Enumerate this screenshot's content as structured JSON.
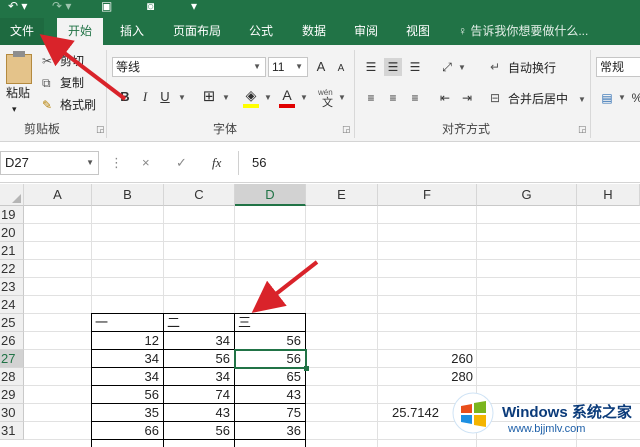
{
  "ribbon_tabs": [
    "文件",
    "开始",
    "插入",
    "页面布局",
    "公式",
    "数据",
    "审阅",
    "视图"
  ],
  "tell_me": "告诉我你想要做什么...",
  "clipboard": {
    "paste": "粘贴",
    "cut": "剪切",
    "copy": "复制",
    "format_painter": "格式刷",
    "label": "剪贴板"
  },
  "font": {
    "name": "等线",
    "size": "11",
    "label": "字体",
    "grow": "A",
    "shrink": "A",
    "bold": "B",
    "italic": "I",
    "underline": "U",
    "font_color": "A",
    "phonetic": "wén"
  },
  "alignment": {
    "wrap": "自动换行",
    "merge": "合并后居中",
    "label": "对齐方式"
  },
  "number": {
    "format": "常规"
  },
  "formula_bar": {
    "name_box": "D27",
    "fx": "fx",
    "cancel": "×",
    "enter": "✓",
    "value": "56"
  },
  "columns": [
    "A",
    "B",
    "C",
    "D",
    "E",
    "F",
    "G",
    "H"
  ],
  "rows": [
    "19",
    "20",
    "21",
    "22",
    "23",
    "24",
    "25",
    "26",
    "27",
    "28",
    "29",
    "30",
    "31"
  ],
  "table": {
    "headers": [
      "一",
      "二",
      "三"
    ],
    "rows": [
      [
        "12",
        "34",
        "56"
      ],
      [
        "34",
        "56",
        "56"
      ],
      [
        "34",
        "34",
        "65"
      ],
      [
        "56",
        "74",
        "43"
      ],
      [
        "35",
        "43",
        "75"
      ],
      [
        "66",
        "56",
        "36"
      ]
    ]
  },
  "extra": {
    "f27": "260",
    "f28": "280",
    "e30": "25.7142"
  },
  "watermark": {
    "title": "Windows 系统之家",
    "url": "www.bjjmlv.com"
  },
  "colors": {
    "excel_green": "#217346",
    "arrow_red": "#d9232a"
  },
  "annotation": "red-arrows"
}
